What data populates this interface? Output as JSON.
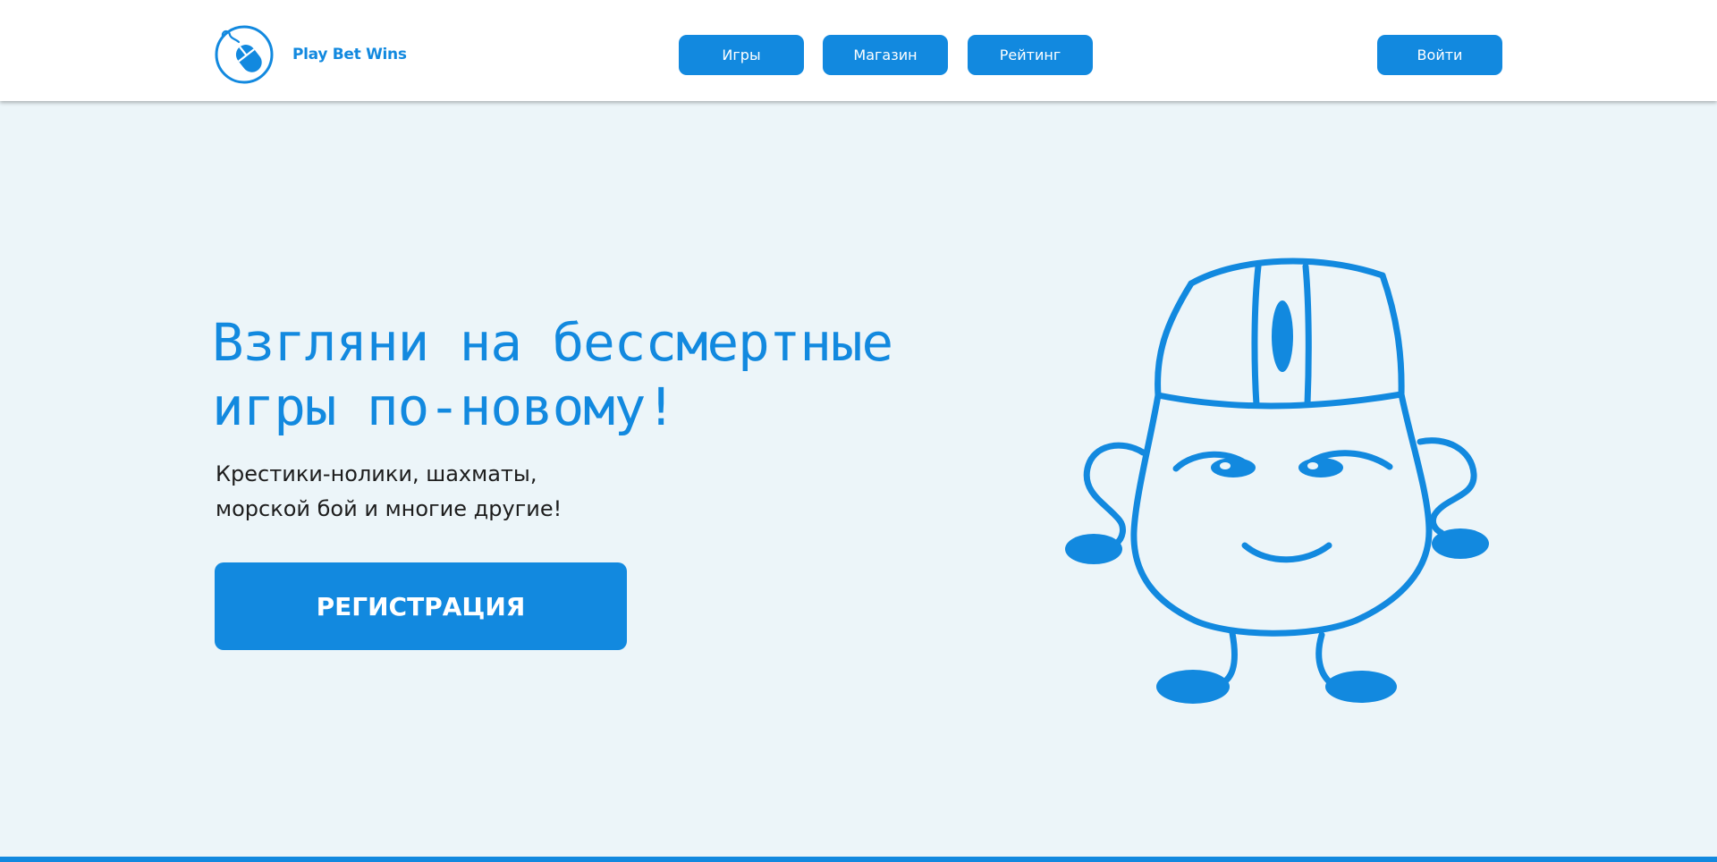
{
  "header": {
    "brand": "Play Bet Wins",
    "nav": {
      "games": "Игры",
      "shop": "Магазин",
      "rating": "Рейтинг"
    },
    "login_label": "Войти"
  },
  "hero": {
    "title_line1": "Взгляни на бессмертные",
    "title_line2": "игры по-новому!",
    "subtitle_line1": "Крестики-нолики, шахматы,",
    "subtitle_line2": "морской бой и многие другие!",
    "register_label": "РЕГИСТРАЦИЯ"
  },
  "icons": {
    "logo": "mouse-mascot-icon",
    "mascot": "mouse-mascot-illustration"
  },
  "colors": {
    "accent": "#1289df",
    "page_background": "#ecf5f9",
    "header_background": "#ffffff",
    "text": "#1d1d1d"
  }
}
